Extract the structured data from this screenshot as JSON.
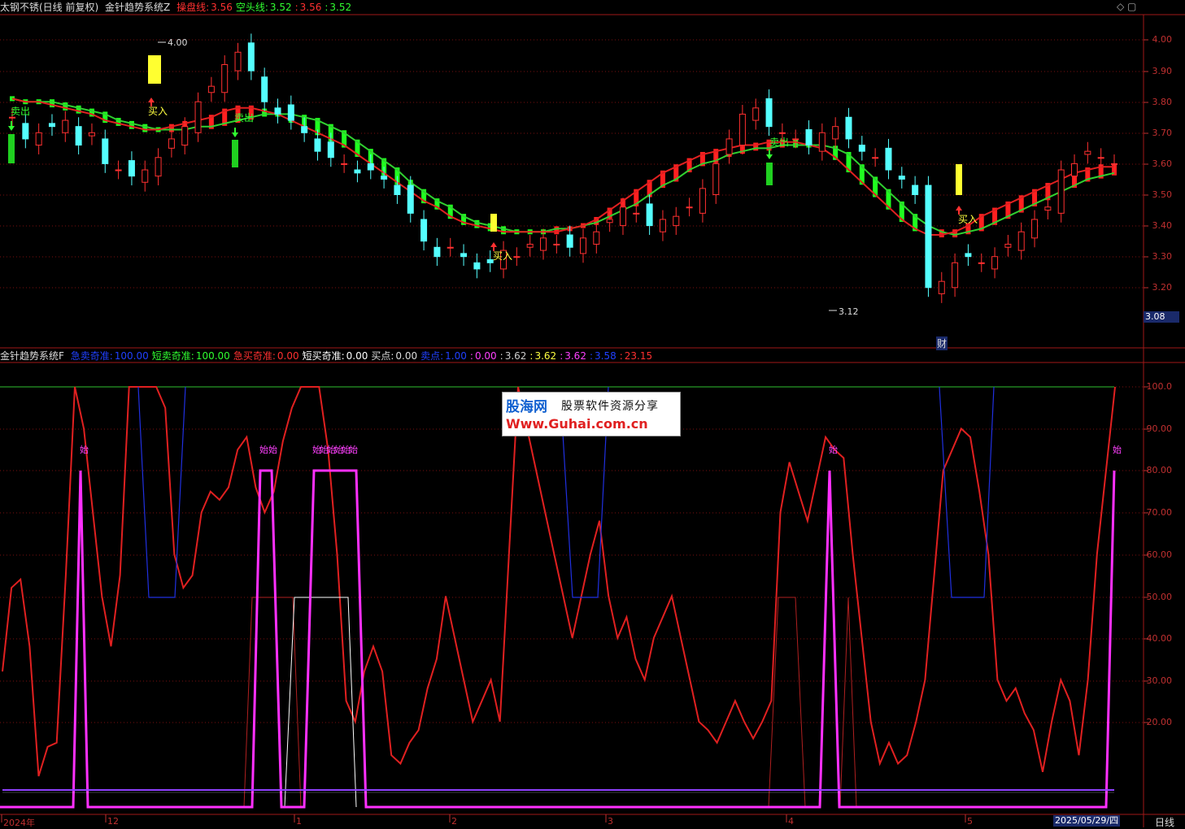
{
  "top_header": {
    "stock": "太钢不锈(日线 前复权)",
    "indicator": "金针趋势系统Z",
    "items": [
      {
        "label": "操盘线:",
        "value": "3.56",
        "color": "#ff3030",
        "valcolor": "#ff3030"
      },
      {
        "label": "空头线:",
        "value": "3.52",
        "color": "#30ff30",
        "valcolor": "#30ff30"
      },
      {
        "label": ":",
        "value": "3.56",
        "color": "#ff3030",
        "valcolor": "#ff3030"
      },
      {
        "label": ":",
        "value": "3.52",
        "color": "#30ff30",
        "valcolor": "#30ff30"
      }
    ]
  },
  "bottom_header": {
    "indicator": "金针趋势系统F",
    "items": [
      {
        "label": "急卖奇准:",
        "value": "100.00",
        "color": "#2040ff"
      },
      {
        "label": "短卖奇准:",
        "value": "100.00",
        "color": "#30ff30"
      },
      {
        "label": "急买奇准:",
        "value": "0.00",
        "color": "#ff3030"
      },
      {
        "label": "短买奇准:",
        "value": "0.00",
        "color": "#ffffff"
      },
      {
        "label": "买点:",
        "value": "0.00",
        "color": "#dddddd"
      },
      {
        "label": "卖点:",
        "value": "1.00",
        "color": "#2040ff"
      },
      {
        "label": ":",
        "value": "0.00",
        "color": "#ff40ff"
      },
      {
        "label": ":",
        "value": "3.62",
        "color": "#cccccc"
      },
      {
        "label": ":",
        "value": "3.62",
        "color": "#ffff40"
      },
      {
        "label": ":",
        "value": "3.62",
        "color": "#ff40ff"
      },
      {
        "label": ":",
        "value": "3.58",
        "color": "#2040ff"
      },
      {
        "label": ":",
        "value": "23.15",
        "color": "#ff3030"
      }
    ]
  },
  "price_axis": [
    "4.00",
    "3.90",
    "3.80",
    "3.70",
    "3.60",
    "3.50",
    "3.40",
    "3.30",
    "3.20"
  ],
  "price_current": "3.08",
  "osc_axis": [
    "100.0",
    "90.00",
    "80.00",
    "70.00",
    "60.00",
    "50.00",
    "40.00",
    "30.00",
    "20.00"
  ],
  "x_axis": [
    "2024年",
    "12",
    "1",
    "2",
    "3",
    "4",
    "5"
  ],
  "x_current": "2025/05/29/四",
  "period": "日线",
  "annotations": {
    "high": "4.00",
    "low": "3.12",
    "buy": "买入",
    "sell": "卖出",
    "fin": "财",
    "start": "始",
    "start_multi": "始始",
    "start_long": "始始始始始始"
  },
  "watermark": {
    "line1a": "股海网",
    "line1b": "股票软件资源分享",
    "line2": "Www.Guhai.com.cn"
  },
  "colors": {
    "up": "#ff3030",
    "down": "#54ffff",
    "ribbon_red": "#ff2020",
    "ribbon_green": "#20ff20",
    "grid": "#7a1010"
  },
  "chart_data": {
    "type": "candlestick",
    "price_range": [
      3.08,
      4.05
    ],
    "ribbon_fast": [
      3.81,
      3.8,
      3.8,
      3.79,
      3.78,
      3.77,
      3.76,
      3.74,
      3.73,
      3.72,
      3.71,
      3.71,
      3.72,
      3.73,
      3.74,
      3.75,
      3.77,
      3.78,
      3.78,
      3.77,
      3.76,
      3.74,
      3.72,
      3.7,
      3.68,
      3.66,
      3.63,
      3.6,
      3.57,
      3.54,
      3.51,
      3.48,
      3.46,
      3.43,
      3.41,
      3.4,
      3.39,
      3.38,
      3.38,
      3.38,
      3.38,
      3.38,
      3.39,
      3.4,
      3.42,
      3.45,
      3.48,
      3.51,
      3.54,
      3.57,
      3.59,
      3.61,
      3.63,
      3.64,
      3.65,
      3.66,
      3.66,
      3.67,
      3.67,
      3.67,
      3.66,
      3.65,
      3.62,
      3.58,
      3.54,
      3.5,
      3.46,
      3.42,
      3.39,
      3.37,
      3.37,
      3.38,
      3.4,
      3.43,
      3.45,
      3.47,
      3.49,
      3.51,
      3.53,
      3.55,
      3.57,
      3.58,
      3.59,
      3.59
    ],
    "ribbon_slow": [
      3.81,
      3.8,
      3.8,
      3.8,
      3.79,
      3.78,
      3.77,
      3.76,
      3.74,
      3.73,
      3.72,
      3.71,
      3.71,
      3.71,
      3.72,
      3.72,
      3.73,
      3.74,
      3.75,
      3.76,
      3.76,
      3.76,
      3.75,
      3.74,
      3.72,
      3.7,
      3.67,
      3.64,
      3.61,
      3.58,
      3.54,
      3.51,
      3.48,
      3.46,
      3.43,
      3.41,
      3.4,
      3.39,
      3.38,
      3.38,
      3.38,
      3.39,
      3.39,
      3.4,
      3.41,
      3.43,
      3.45,
      3.47,
      3.5,
      3.53,
      3.55,
      3.58,
      3.6,
      3.61,
      3.63,
      3.64,
      3.65,
      3.65,
      3.66,
      3.66,
      3.66,
      3.66,
      3.65,
      3.63,
      3.59,
      3.55,
      3.51,
      3.47,
      3.43,
      3.4,
      3.38,
      3.37,
      3.38,
      3.39,
      3.41,
      3.43,
      3.45,
      3.47,
      3.49,
      3.51,
      3.53,
      3.55,
      3.56,
      3.57
    ]
  }
}
